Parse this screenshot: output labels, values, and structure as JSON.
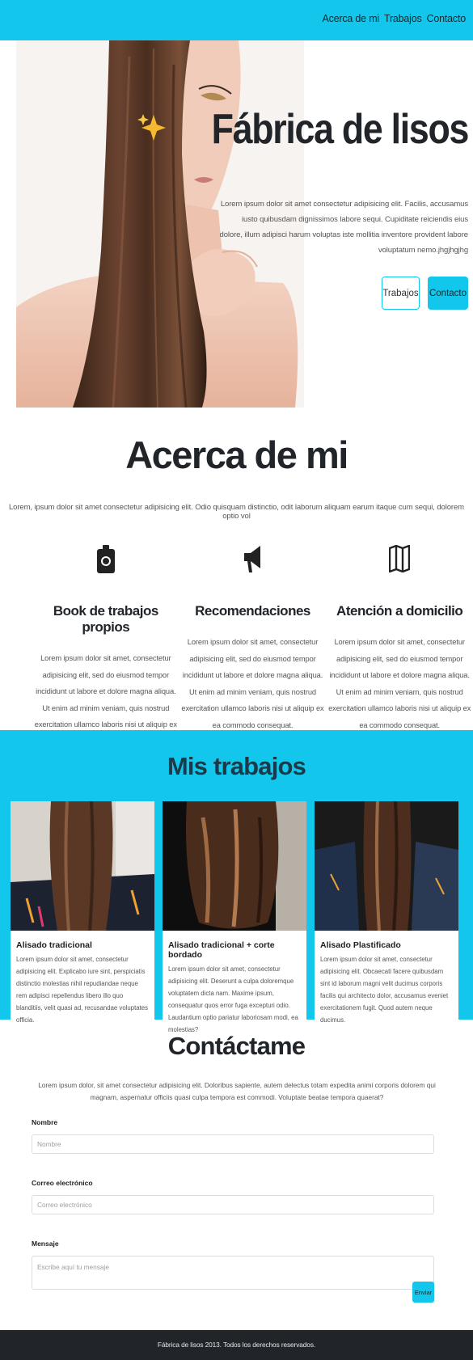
{
  "nav": {
    "links": [
      "Acerca de mi",
      "Trabajos",
      "Contacto"
    ]
  },
  "hero": {
    "title": "Fábrica de lisos",
    "text": "Lorem ipsum dolor sit amet consectetur adipisicing elit. Facilis, accusamus iusto quibusdam dignissimos labore sequi. Cupiditate reiciendis eius dolore, illum adipisci harum voluptas iste mollitia inventore provident labore voluptatum nemo.jhgjhgjhg",
    "btn_works": "Trabajos",
    "btn_contact": "Contacto",
    "sparkle_icon": "sparkles-icon",
    "photo": "woman-long-straight-hair-photo"
  },
  "about": {
    "title": "Acerca de mi",
    "subtitle": "Lorem, ipsum dolor sit amet consectetur adipisicing elit. Odio quisquam distinctio, odit laborum aliquam earum itaque cum sequi, dolorem optio vol",
    "features": [
      {
        "icon": "camera-icon",
        "title": "Book de trabajos propios",
        "text": "Lorem ipsum dolor sit amet, consectetur adipisicing elit, sed do eiusmod tempor incididunt ut labore et dolore magna aliqua. Ut enim ad minim veniam, quis nostrud exercitation ullamco laboris nisi ut aliquip ex ea commodo consequat."
      },
      {
        "icon": "megaphone-icon",
        "title": "Recomendaciones",
        "text": "Lorem ipsum dolor sit amet, consectetur adipisicing elit, sed do eiusmod tempor incididunt ut labore et dolore magna aliqua. Ut enim ad minim veniam, quis nostrud exercitation ullamco laboris nisi ut aliquip ex ea commodo consequat."
      },
      {
        "icon": "map-icon",
        "title": "Atención a domicilio",
        "text": "Lorem ipsum dolor sit amet, consectetur adipisicing elit, sed do eiusmod tempor incididunt ut labore et dolore magna aliqua. Ut enim ad minim veniam, quis nostrud exercitation ullamco laboris nisi ut aliquip ex ea commodo consequat."
      }
    ]
  },
  "works": {
    "title": "Mis trabajos",
    "cards": [
      {
        "title": "Alisado tradicional",
        "text": "Lorem ipsum dolor sit amet, consectetur adipisicing elit. Explicabo iure sint, perspiciatis distinctio molestias nihil repudiandae neque rem adipisci repellendus libero illo quo blanditiis, velit quasi ad, recusandae voluptates officia."
      },
      {
        "title": "Alisado tradicional + corte bordado",
        "text": "Lorem ipsum dolor sit amet, consectetur adipisicing elit. Deserunt a culpa doloremque voluptatem dicta nam. Maxime ipsum, consequatur quos error fuga excepturi odio. Laudantium optio pariatur laboriosam modi, ea molestias?"
      },
      {
        "title": "Alisado Plastificado",
        "text": "Lorem ipsum dolor sit amet, consectetur adipisicing elit. Obcaecati facere quibusdam sint id laborum magni velit ducimus corporis facilis qui architecto dolor, accusamus eveniet exercitationem fugit. Quod autem neque ducimus."
      }
    ]
  },
  "contact": {
    "title": "Contáctame",
    "subtitle": "Lorem ipsum dolor, sit amet consectetur adipisicing elit. Doloribus sapiente, autem delectus totam expedita animi corporis dolorem qui magnam, aspernatur officiis quasi culpa tempora est commodi. Voluptate beatae tempora quaerat?",
    "name_label": "Nombre",
    "name_placeholder": "Nombre",
    "email_label": "Correo electrónico",
    "email_placeholder": "Correo electrónico",
    "message_label": "Mensaje",
    "message_placeholder": "Escribe aquí tu mensaje",
    "send_label": "Enviar"
  },
  "footer": {
    "text": "Fábrica de lisos 2013. Todos los derechos reservados."
  },
  "colors": {
    "accent": "#13c7ec",
    "footer": "#212529"
  }
}
